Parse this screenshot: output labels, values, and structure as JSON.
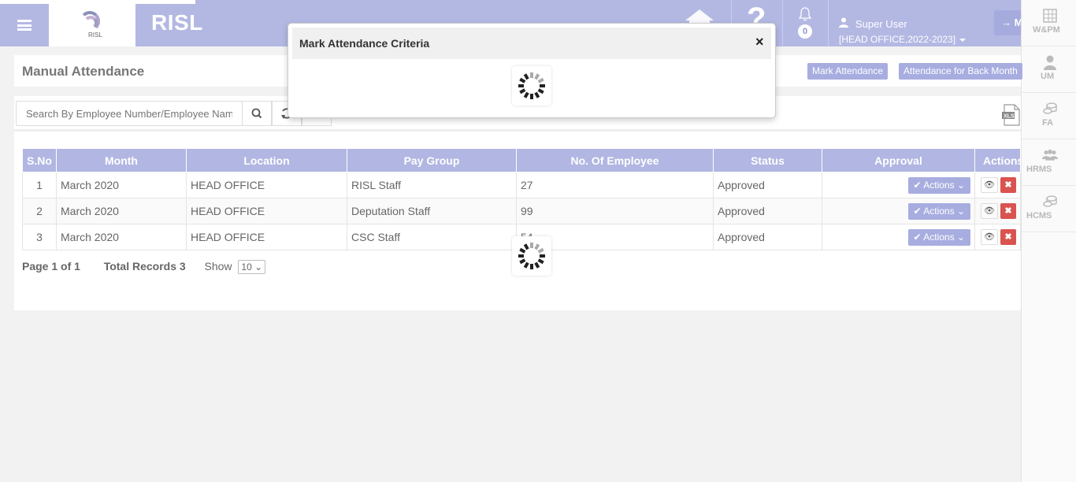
{
  "header": {
    "brand": "RISL",
    "logo_text": "RISL",
    "help_glyph": "?",
    "notification_count": "0",
    "user_name": "Super User",
    "user_office": "[HEAD OFFICE,2022-2023]",
    "module_button": "→ M"
  },
  "modules": [
    {
      "label": "W&PM",
      "icon": "grid-icon"
    },
    {
      "label": "UM",
      "icon": "user-icon"
    },
    {
      "label": "FA",
      "icon": "coins-icon"
    },
    {
      "label": "HRMS",
      "icon": "people-icon"
    },
    {
      "label": "HCMS",
      "icon": "coins-icon"
    }
  ],
  "page": {
    "title": "Manual Attendance",
    "mark_attendance_label": "Mark Attendance",
    "back_month_label": "Attendance for Back Month"
  },
  "search": {
    "placeholder": "Search By Employee Number/Employee Name"
  },
  "table": {
    "headers": [
      "S.No",
      "Month",
      "Location",
      "Pay Group",
      "No. Of Employee",
      "Status",
      "Approval",
      "Actions"
    ],
    "rows": [
      {
        "sno": "1",
        "month": "March 2020",
        "location": "HEAD OFFICE",
        "pay_group": "RISL Staff",
        "employees": "27",
        "status": "Approved",
        "approval": "Actions"
      },
      {
        "sno": "2",
        "month": "March 2020",
        "location": "HEAD OFFICE",
        "pay_group": "Deputation Staff",
        "employees": "99",
        "status": "Approved",
        "approval": "Actions"
      },
      {
        "sno": "3",
        "month": "March 2020",
        "location": "HEAD OFFICE",
        "pay_group": "CSC Staff",
        "employees": "54",
        "status": "Approved",
        "approval": "Actions"
      }
    ]
  },
  "pager": {
    "page_text": "Page 1 of 1",
    "total_text": "Total Records 3",
    "show_label": "Show",
    "page_size": "10"
  },
  "modal": {
    "title": "Mark Attendance Criteria",
    "close_glyph": "×"
  },
  "colors": {
    "accent": "#b3b8e3",
    "button": "#a8ade0",
    "danger": "#d9534f"
  }
}
